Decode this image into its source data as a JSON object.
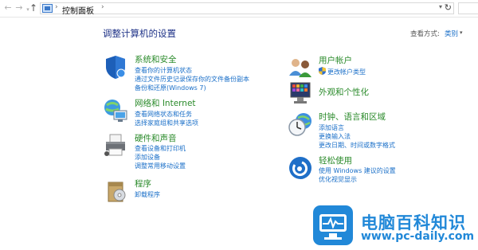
{
  "address_bar": {
    "back_icon": "←",
    "forward_icon": "→",
    "dropdown_icon": "▾",
    "up_icon": "↑",
    "breadcrumb_sep": "›",
    "breadcrumb": "控制面板",
    "path_dropdown_icon": "▾",
    "refresh_icon": "↻"
  },
  "header": {
    "title": "调整计算机的设置",
    "view_by_label": "查看方式:",
    "view_by_value": "类别",
    "view_by_dropdown_icon": "▾"
  },
  "categories": [
    {
      "title": "系统和安全",
      "icon": "shield-icon",
      "links": [
        "查看你的计算机状态",
        "通过文件历史记录保存你的文件备份副本",
        "备份和还原(Windows 7)"
      ]
    },
    {
      "title": "网络和 Internet",
      "icon": "network-icon",
      "links": [
        "查看网络状态和任务",
        "选择家庭组和共享选项"
      ]
    },
    {
      "title": "硬件和声音",
      "icon": "printer-icon",
      "links": [
        "查看设备和打印机",
        "添加设备",
        "调整常用移动设置"
      ]
    },
    {
      "title": "程序",
      "icon": "programs-icon",
      "links": [
        "卸载程序"
      ]
    },
    {
      "title": "用户帐户",
      "icon": "users-icon",
      "links": [
        "更改帐户类型"
      ]
    },
    {
      "title": "外观和个性化",
      "icon": "appearance-icon",
      "links": []
    },
    {
      "title": "时钟、语言和区域",
      "icon": "clock-globe-icon",
      "links": [
        "添加语言",
        "更换输入法",
        "更改日期、时间或数字格式"
      ]
    },
    {
      "title": "轻松使用",
      "icon": "ease-of-access-icon",
      "links": [
        "使用 Windows 建议的设置",
        "优化视觉显示"
      ]
    }
  ],
  "watermark": {
    "title": "电脑百科知识",
    "url": "www.pc-daily.com"
  },
  "colors": {
    "title_blue": "#1e3287",
    "category_green": "#2a8a2a",
    "link_blue": "#1a6fc8",
    "watermark_blue": "#2188d8"
  }
}
